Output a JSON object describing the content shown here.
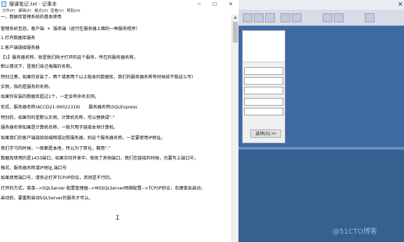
{
  "window": {
    "title": "搜课笔记.txt - 记事本",
    "minimize": "─",
    "maximize": "☐",
    "close": "✕"
  },
  "menu": [
    "文件(F)",
    "编辑(E)",
    "格式(O)",
    "查看(V)",
    "帮助(H)"
  ],
  "lines": [
    "一、数据库管理系统的基本使用",
    "管理系统包括，客户端  +  服务端（运行在服务器上面的一种服务程序）",
    "1.打开数据库服务",
    "2.客户端链接服务器",
    "【1】服务器名称，就是我们刚才打开的这个服务，所在的服务器名称。",
    "默认情况下，是我们自己电脑的名称。",
    "特别注意，如果你安装了，两个或者两个以上版本的数据库，我们的服务器名称有时候就不能这么写!",
    "实例，指的是服务的名称。",
    "如果你安装的数据库超过1个，一定会有命名实例。",
    "形式，服务器名称(ACCD21-06021316)      服务器名称\\SQLExpress",
    "特别的，如果你的是默认实例，计算机名称，可以替换成\".\"",
    "服务器名称如果是计算机名称，一般只用于链接本地计算机。",
    "如果我们的客户端链接局域网或远程服务器，则这个服务器名称，一定要使用IP地址。",
    "我们学习的时候，一般都是本地，所以为了简化，都用\".\"",
    "数据库使用的是1433端口，如果实际开发中，修改了其他端口，我们在链接的时候，也要写上端口号，",
    "格式，服务器名称或IP地址,端口号",
    "如果使用端口号，请务必打开TCP/IP协议，否则是不行的。",
    "打开的方式，菜单-->SQLServer 配置管理器-->MSSQLServer网络配置-->TCP/IP协议，右键单击启动，",
    "启动后，要重新启动SQLServer的服务才可以。"
  ],
  "background": {
    "options_button": "选项(O) >>",
    "watermark": "@51CTO博客",
    "close_glyph": "✕"
  }
}
